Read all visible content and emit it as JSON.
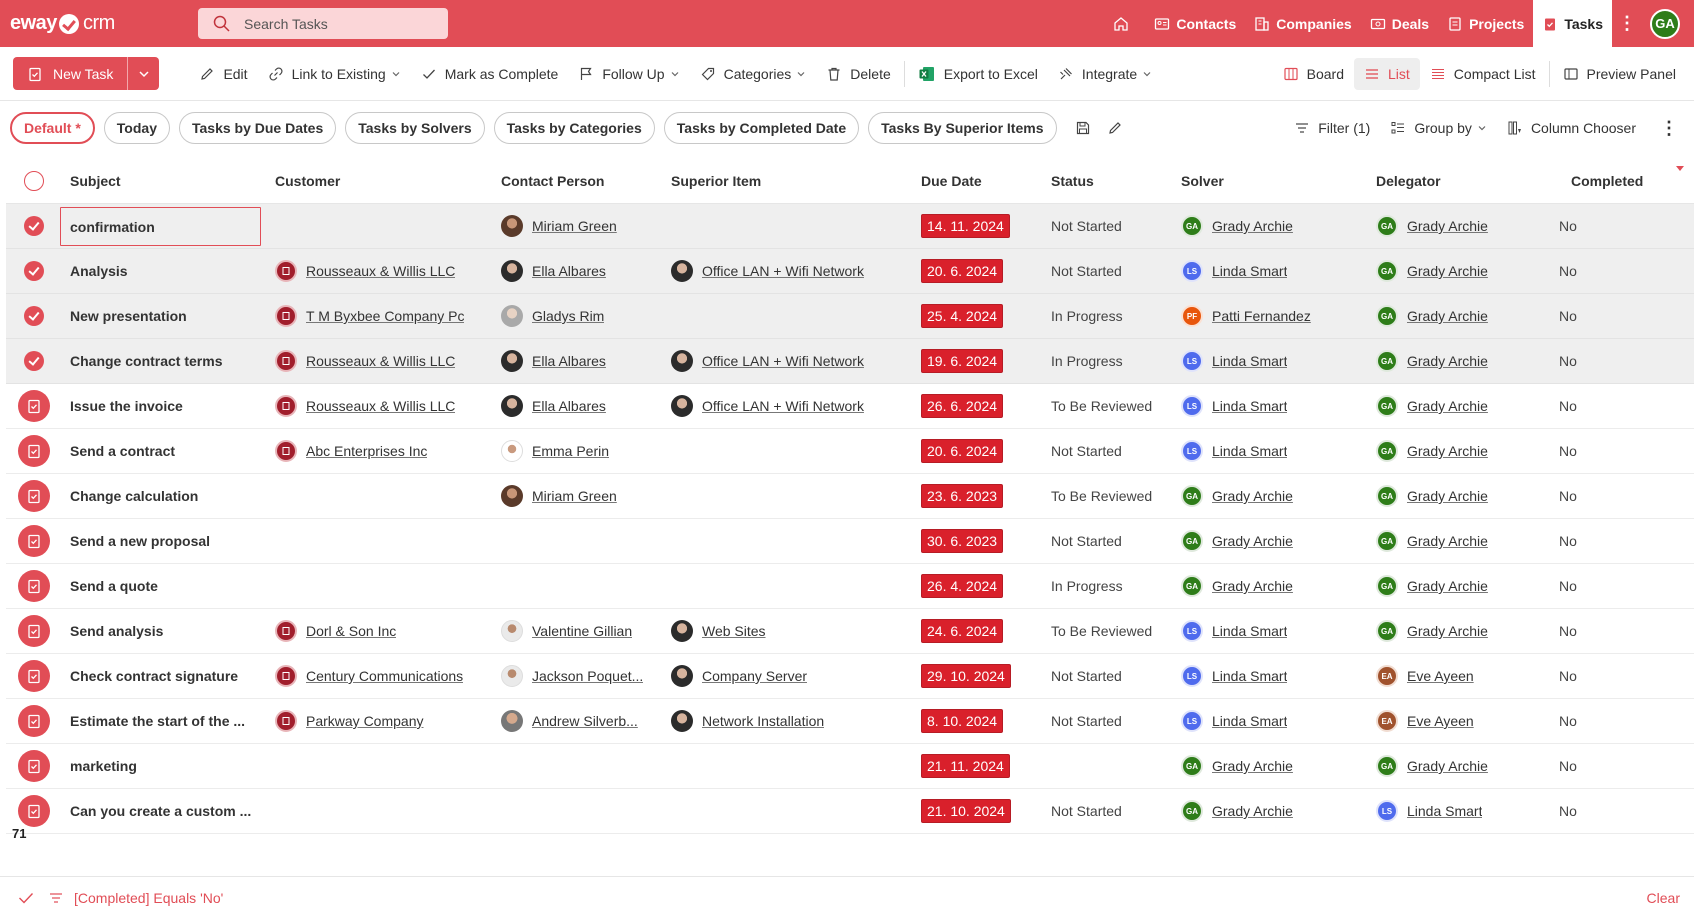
{
  "app": {
    "logo_text_1": "eway",
    "logo_text_2": "crm",
    "search_placeholder": "Search Tasks",
    "user_initials": "GA"
  },
  "nav": {
    "items": [
      {
        "label": "Contacts",
        "icon": "contacts-icon"
      },
      {
        "label": "Companies",
        "icon": "companies-icon"
      },
      {
        "label": "Deals",
        "icon": "deals-icon"
      },
      {
        "label": "Projects",
        "icon": "projects-icon"
      },
      {
        "label": "Tasks",
        "icon": "tasks-icon",
        "active": true
      }
    ]
  },
  "toolbar": {
    "new_task": "New Task",
    "edit": "Edit",
    "link_existing": "Link to Existing",
    "mark_complete": "Mark as Complete",
    "follow_up": "Follow Up",
    "categories": "Categories",
    "delete": "Delete",
    "export_excel": "Export to Excel",
    "integrate": "Integrate",
    "board": "Board",
    "list": "List",
    "compact_list": "Compact List",
    "preview_panel": "Preview Panel"
  },
  "views": {
    "pills": [
      "Default *",
      "Today",
      "Tasks by Due Dates",
      "Tasks by Solvers",
      "Tasks by Categories",
      "Tasks by Completed Date",
      "Tasks By Superior Items"
    ],
    "filter": "Filter (1)",
    "group_by": "Group by",
    "column_chooser": "Column Chooser"
  },
  "grid": {
    "columns": [
      "Subject",
      "Customer",
      "Contact Person",
      "Superior Item",
      "Due Date",
      "Status",
      "Solver",
      "Delegator",
      "Completed"
    ],
    "rows": [
      {
        "subject": "confirmation",
        "customer": "",
        "contact": "Miriam Green",
        "contact_photo": "p1",
        "superior": "",
        "due": "14. 11. 2024",
        "status": "Not Started",
        "solver": "Grady Archie",
        "solver_ini": "GA",
        "solver_col": "green",
        "delegator": "Grady Archie",
        "del_ini": "GA",
        "del_col": "green",
        "completed": "No",
        "selected": true,
        "focus": true
      },
      {
        "subject": "Analysis",
        "customer": "Rousseaux & Willis LLC",
        "contact": "Ella Albares",
        "contact_photo": "p2",
        "superior": "Office LAN + Wifi Network",
        "due": "20. 6. 2024",
        "status": "Not Started",
        "solver": "Linda Smart",
        "solver_ini": "LS",
        "solver_col": "blue",
        "delegator": "Grady Archie",
        "del_ini": "GA",
        "del_col": "green",
        "completed": "No",
        "selected": true
      },
      {
        "subject": "New presentation",
        "customer": "T M Byxbee Company Pc",
        "contact": "Gladys Rim",
        "contact_photo": "p3",
        "superior": "",
        "due": "25. 4. 2024",
        "status": "In Progress",
        "solver": "Patti Fernandez",
        "solver_ini": "PF",
        "solver_col": "orange",
        "delegator": "Grady Archie",
        "del_ini": "GA",
        "del_col": "green",
        "completed": "No",
        "selected": true
      },
      {
        "subject": "Change contract terms",
        "customer": "Rousseaux & Willis LLC",
        "contact": "Ella Albares",
        "contact_photo": "p2",
        "superior": "Office LAN + Wifi Network",
        "due": "19. 6. 2024",
        "status": "In Progress",
        "solver": "Linda Smart",
        "solver_ini": "LS",
        "solver_col": "blue",
        "delegator": "Grady Archie",
        "del_ini": "GA",
        "del_col": "green",
        "completed": "No",
        "selected": true
      },
      {
        "subject": "Issue the invoice",
        "customer": "Rousseaux & Willis LLC",
        "contact": "Ella Albares",
        "contact_photo": "p2",
        "superior": "Office LAN + Wifi Network",
        "due": "26. 6. 2024",
        "status": "To Be Reviewed",
        "solver": "Linda Smart",
        "solver_ini": "LS",
        "solver_col": "blue",
        "delegator": "Grady Archie",
        "del_ini": "GA",
        "del_col": "green",
        "completed": "No"
      },
      {
        "subject": "Send a contract",
        "customer": "Abc Enterprises Inc",
        "contact": "Emma Perin",
        "contact_photo": "p4",
        "superior": "",
        "due": "20. 6. 2024",
        "status": "Not Started",
        "solver": "Linda Smart",
        "solver_ini": "LS",
        "solver_col": "blue",
        "delegator": "Grady Archie",
        "del_ini": "GA",
        "del_col": "green",
        "completed": "No"
      },
      {
        "subject": "Change calculation",
        "customer": "",
        "contact": "Miriam Green",
        "contact_photo": "p1",
        "superior": "",
        "due": "23. 6. 2023",
        "status": "To Be Reviewed",
        "solver": "Grady Archie",
        "solver_ini": "GA",
        "solver_col": "green",
        "delegator": "Grady Archie",
        "del_ini": "GA",
        "del_col": "green",
        "completed": "No"
      },
      {
        "subject": "Send a new proposal",
        "customer": "",
        "contact": "",
        "contact_photo": "",
        "superior": "",
        "due": "30. 6. 2023",
        "status": "Not Started",
        "solver": "Grady Archie",
        "solver_ini": "GA",
        "solver_col": "green",
        "delegator": "Grady Archie",
        "del_ini": "GA",
        "del_col": "green",
        "completed": "No"
      },
      {
        "subject": "Send a quote",
        "customer": "",
        "contact": "",
        "contact_photo": "",
        "superior": "",
        "due": "26. 4. 2024",
        "status": "In Progress",
        "solver": "Grady Archie",
        "solver_ini": "GA",
        "solver_col": "green",
        "delegator": "Grady Archie",
        "del_ini": "GA",
        "del_col": "green",
        "completed": "No"
      },
      {
        "subject": "Send analysis",
        "customer": "Dorl & Son Inc",
        "contact": "Valentine Gillian",
        "contact_photo": "p5",
        "superior": "Web Sites",
        "due": "24. 6. 2024",
        "status": "To Be Reviewed",
        "solver": "Linda Smart",
        "solver_ini": "LS",
        "solver_col": "blue",
        "delegator": "Grady Archie",
        "del_ini": "GA",
        "del_col": "green",
        "completed": "No"
      },
      {
        "subject": "Check contract signature",
        "customer": "Century Communications",
        "contact": "Jackson Poquet...",
        "contact_photo": "p5",
        "superior": "Company Server",
        "due": "29. 10. 2024",
        "status": "Not Started",
        "solver": "Linda Smart",
        "solver_ini": "LS",
        "solver_col": "blue",
        "delegator": "Eve Ayeen",
        "del_ini": "EA",
        "del_col": "brown",
        "completed": "No"
      },
      {
        "subject": "Estimate the start of the ...",
        "customer": "Parkway Company",
        "contact": "Andrew Silverb...",
        "contact_photo": "p6",
        "superior": "Network Installation",
        "due": "8. 10. 2024",
        "status": "Not Started",
        "solver": "Linda Smart",
        "solver_ini": "LS",
        "solver_col": "blue",
        "delegator": "Eve Ayeen",
        "del_ini": "EA",
        "del_col": "brown",
        "completed": "No"
      },
      {
        "subject": "marketing",
        "customer": "",
        "contact": "",
        "contact_photo": "",
        "superior": "",
        "due": "21. 11. 2024",
        "status": "",
        "solver": "Grady Archie",
        "solver_ini": "GA",
        "solver_col": "green",
        "delegator": "Grady Archie",
        "del_ini": "GA",
        "del_col": "green",
        "completed": "No"
      },
      {
        "subject": "Can you create a custom ...",
        "customer": "",
        "contact": "",
        "contact_photo": "",
        "superior": "",
        "due": "21. 10. 2024",
        "status": "Not Started",
        "solver": "Grady Archie",
        "solver_ini": "GA",
        "solver_col": "green",
        "delegator": "Linda Smart",
        "del_ini": "LS",
        "del_col": "blue",
        "completed": "No"
      }
    ],
    "total_count": "71"
  },
  "filterbar": {
    "text": "[Completed] Equals 'No'",
    "clear": "Clear"
  },
  "colors": {
    "brand": "#e14d56",
    "date_badge": "#d9202b"
  }
}
